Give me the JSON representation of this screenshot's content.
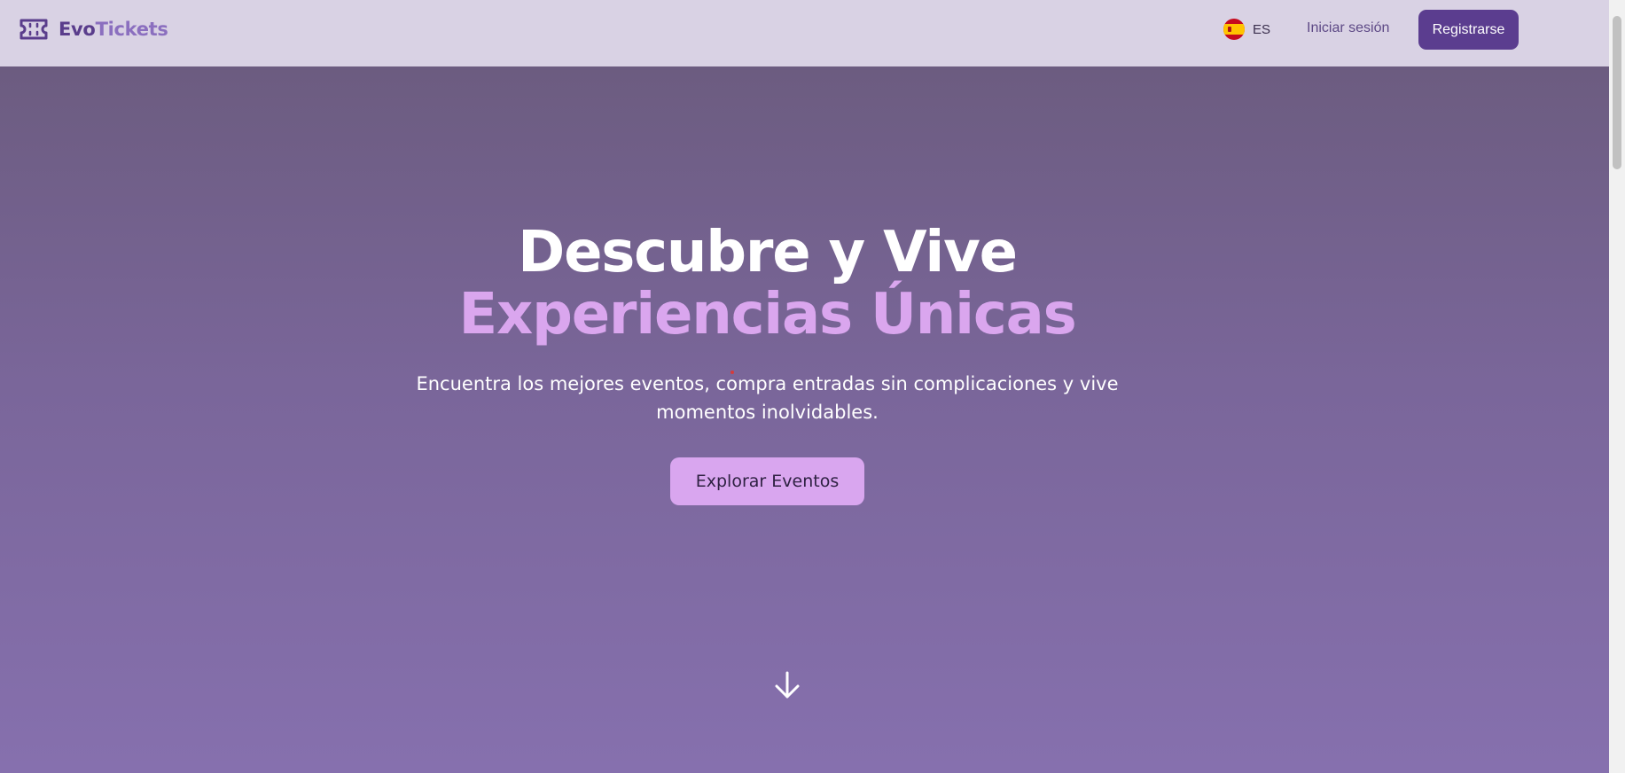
{
  "header": {
    "logo": {
      "part1": "Evo",
      "part2": "Tickets",
      "icon": "ticket-icon"
    },
    "language": {
      "code": "ES",
      "flag_icon": "spain-flag-icon"
    },
    "login_label": "Iniciar sesión",
    "register_label": "Registrarse"
  },
  "hero": {
    "title_line1": "Descubre y Vive",
    "title_line2": "Experiencias Únicas",
    "subtitle": "Encuentra los mejores eventos, compra entradas sin complicaciones y vive momentos inolvidables.",
    "cta_label": "Explorar Eventos",
    "scroll_icon": "arrow-down-icon"
  },
  "colors": {
    "header_bg": "#d9d2e4",
    "brand_primary": "#5b3d8f",
    "brand_light": "#8b6fbf",
    "accent": "#daa6ee",
    "hero_top": "#6c5c80",
    "hero_bottom": "#8670ae"
  }
}
